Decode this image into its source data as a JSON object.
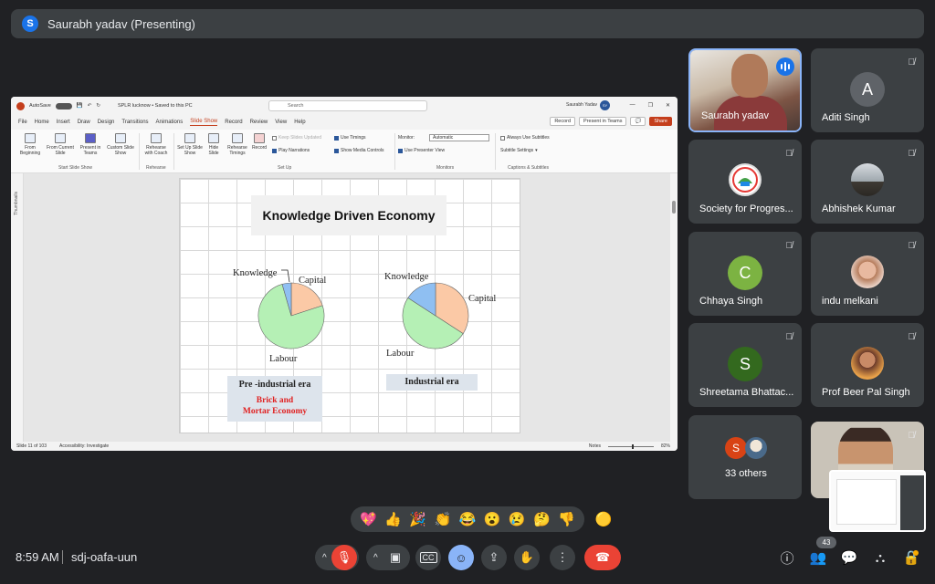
{
  "presenting": {
    "avatar_letter": "S",
    "text": "Saurabh yadav (Presenting)"
  },
  "ppt": {
    "autosave_label": "AutoSave",
    "toggle_label": "Off",
    "doc_title": "SPLR lucknow • Saved to this PC",
    "search_placeholder": "Search",
    "user": "Saurabh Yadav",
    "user_initials": "SY",
    "window_buttons": [
      "—",
      "❐",
      "✕"
    ],
    "menu": [
      "File",
      "Home",
      "Insert",
      "Draw",
      "Design",
      "Transitions",
      "Animations",
      "Slide Show",
      "Record",
      "Review",
      "View",
      "Help"
    ],
    "active_menu": "Slide Show",
    "record_btn": "Record",
    "present_teams_btn": "Present in Teams",
    "share_btn": "Share",
    "ribbon": {
      "from_beginning": "From Beginning",
      "from_current": "From Current Slide",
      "present_teams": "Present in Teams",
      "custom_show": "Custom Slide Show",
      "rehearse_coach": "Rehearse with Coach",
      "set_up": "Set Up Slide Show",
      "hide_slide": "Hide Slide",
      "rehearse_timings": "Rehearse Timings",
      "record": "Record",
      "keep_updated": "Keep Slides Updated",
      "play_narrations": "Play Narrations",
      "use_timings": "Use Timings",
      "show_media": "Show Media Controls",
      "monitor_label": "Monitor:",
      "monitor_value": "Automatic",
      "presenter_view": "Use Presenter View",
      "always_subtitles": "Always Use Subtitles",
      "subtitle_settings": "Subtitle Settings",
      "groups": [
        "Start Slide Show",
        "Rehearse",
        "Set Up",
        "Monitors",
        "Captions & Subtitles"
      ]
    },
    "thumbnails_label": "Thumbnails",
    "status_slide": "Slide 11 of 103",
    "status_accessibility": "Accessibility: Investigate",
    "status_notes": "Notes",
    "zoom": "82%"
  },
  "slide": {
    "title": "Knowledge Driven Economy",
    "pie1": {
      "labels": [
        "Knowledge",
        "Capital",
        "Labour"
      ],
      "era": "Pre -industrial era",
      "sub": "Brick and Mortar Economy"
    },
    "pie2": {
      "labels": [
        "Knowledge",
        "Capital",
        "Labour"
      ],
      "era": "Industrial era"
    }
  },
  "participants": [
    {
      "name": "Saurabh yadav",
      "type": "speaker"
    },
    {
      "name": "Aditi Singh",
      "type": "letter",
      "letter": "A",
      "color": "#5f6368"
    },
    {
      "name": "Society for Progres...",
      "type": "logo"
    },
    {
      "name": "Abhishek Kumar",
      "type": "photo"
    },
    {
      "name": "Chhaya Singh",
      "type": "letter",
      "letter": "C",
      "color": "#7cb342"
    },
    {
      "name": "indu melkani",
      "type": "photo"
    },
    {
      "name": "Shreetama Bhattac...",
      "type": "letter",
      "letter": "S",
      "color": "#33691e"
    },
    {
      "name": "Prof Beer Pal Singh",
      "type": "photo"
    },
    {
      "name": "33 others",
      "type": "others",
      "letter": "S"
    }
  ],
  "reactions": [
    "💖",
    "👍",
    "🎉",
    "👏",
    "😂",
    "😮",
    "😢",
    "🤔",
    "👎"
  ],
  "extra_reaction": "🟡",
  "bottom": {
    "time": "8:59 AM",
    "meeting_code": "sdj-oafa-uun",
    "participant_count": "43"
  }
}
